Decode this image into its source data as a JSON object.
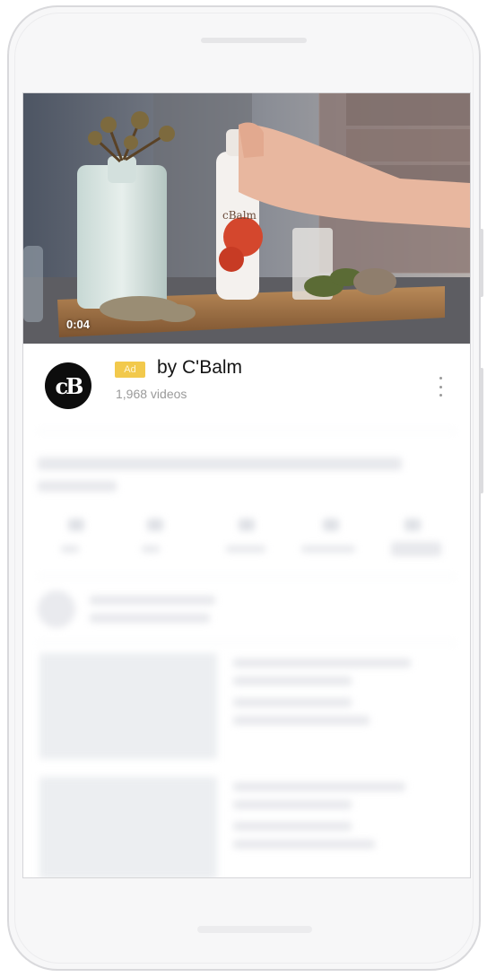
{
  "video": {
    "timestamp": "0:04"
  },
  "ad": {
    "badge": "Ad",
    "channel_title": "by C'Balm",
    "channel_subtitle": "1,968 videos",
    "logo_text": "cB",
    "badge_color": "#f2c94c"
  },
  "colors": {
    "frame_bg": "#f7f7f8",
    "logo_bg": "#0d0d0d"
  }
}
